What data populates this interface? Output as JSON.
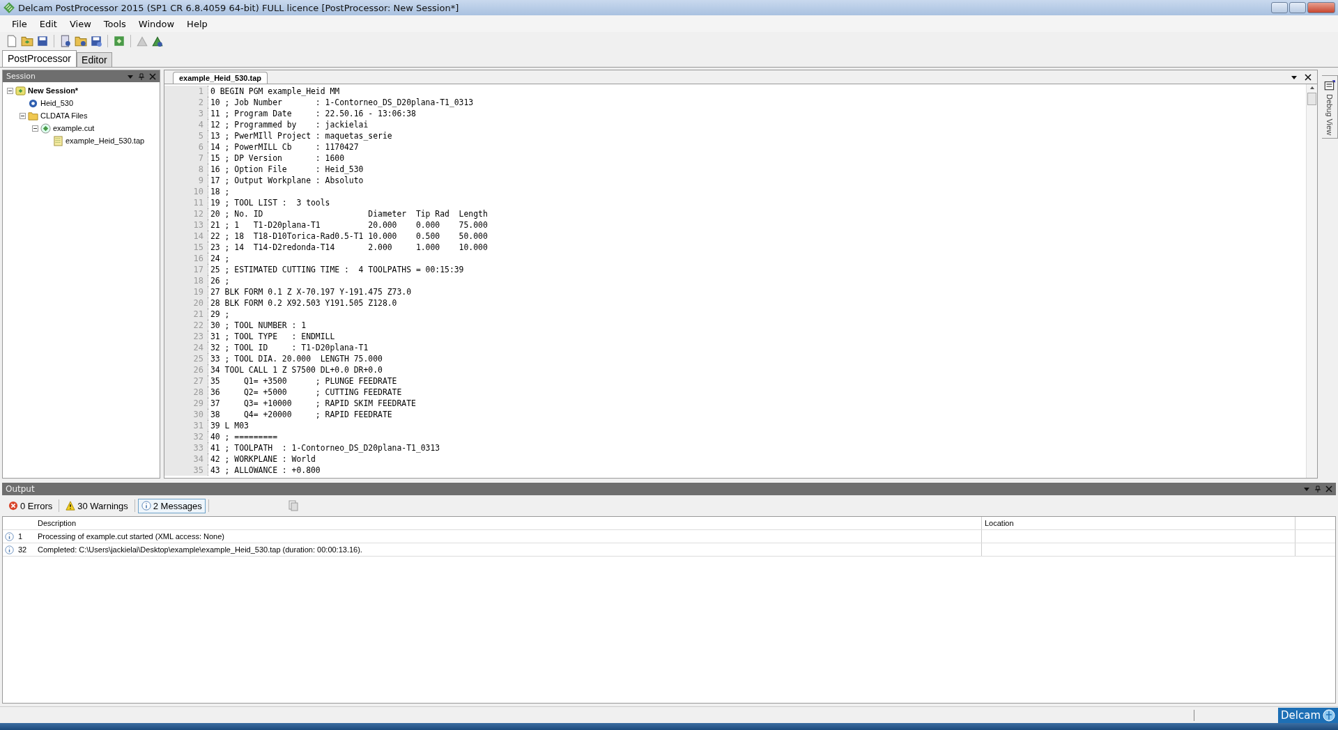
{
  "window": {
    "title": "Delcam PostProcessor 2015 (SP1 CR 6.8.4059 64-bit) FULL licence [PostProcessor: New Session*]"
  },
  "menu": [
    "File",
    "Edit",
    "View",
    "Tools",
    "Window",
    "Help"
  ],
  "tabs": [
    {
      "label": "PostProcessor",
      "selected": true
    },
    {
      "label": "Editor",
      "selected": false
    }
  ],
  "session": {
    "title": "Session",
    "tree": [
      {
        "label": "New Session*",
        "kind": "session",
        "expanded": true,
        "children": [
          {
            "label": "Heid_530",
            "kind": "option"
          },
          {
            "label": "CLDATA Files",
            "kind": "folder",
            "expanded": true,
            "children": [
              {
                "label": "example.cut",
                "kind": "cut",
                "expanded": true,
                "children": [
                  {
                    "label": "example_Heid_530.tap",
                    "kind": "tap"
                  }
                ]
              }
            ]
          }
        ]
      }
    ]
  },
  "editor": {
    "tab": "example_Heid_530.tap",
    "lines": [
      {
        "n": "1",
        "text": "0 BEGIN PGM example_Heid MM"
      },
      {
        "n": "2",
        "text": "10 ; Job Number       : 1-Contorneo_DS_D20plana-T1_0313"
      },
      {
        "n": "3",
        "text": "11 ; Program Date     : 22.50.16 - 13:06:38"
      },
      {
        "n": "4",
        "text": "12 ; Programmed by    : jackielai"
      },
      {
        "n": "5",
        "text": "13 ; PwerMIll Project : maquetas_serie"
      },
      {
        "n": "6",
        "text": "14 ; PowerMILL Cb     : 1170427"
      },
      {
        "n": "7",
        "text": "15 ; DP Version       : 1600"
      },
      {
        "n": "8",
        "text": "16 ; Option File      : Heid_530"
      },
      {
        "n": "9",
        "text": "17 ; Output Workplane : Absoluto"
      },
      {
        "n": "10",
        "text": "18 ;"
      },
      {
        "n": "11",
        "text": "19 ; TOOL LIST :  3 tools"
      },
      {
        "n": "12",
        "text": "20 ; No. ID                      Diameter  Tip Rad  Length"
      },
      {
        "n": "13",
        "text": "21 ; 1   T1-D20plana-T1          20.000    0.000    75.000"
      },
      {
        "n": "14",
        "text": "22 ; 18  T18-D10Torica-Rad0.5-T1 10.000    0.500    50.000"
      },
      {
        "n": "15",
        "text": "23 ; 14  T14-D2redonda-T14       2.000     1.000    10.000"
      },
      {
        "n": "16",
        "text": "24 ;"
      },
      {
        "n": "17",
        "text": "25 ; ESTIMATED CUTTING TIME :  4 TOOLPATHS = 00:15:39"
      },
      {
        "n": "18",
        "text": "26 ;"
      },
      {
        "n": "19",
        "text": "27 BLK FORM 0.1 Z X-70.197 Y-191.475 Z73.0"
      },
      {
        "n": "20",
        "text": "28 BLK FORM 0.2 X92.503 Y191.505 Z128.0"
      },
      {
        "n": "21",
        "text": "29 ;"
      },
      {
        "n": "22",
        "text": "30 ; TOOL NUMBER : 1"
      },
      {
        "n": "23",
        "text": "31 ; TOOL TYPE   : ENDMILL"
      },
      {
        "n": "24",
        "text": "32 ; TOOL ID     : T1-D20plana-T1"
      },
      {
        "n": "25",
        "text": "33 ; TOOL DIA. 20.000  LENGTH 75.000"
      },
      {
        "n": "26",
        "text": "34 TOOL CALL 1 Z S7500 DL+0.0 DR+0.0"
      },
      {
        "n": "27",
        "text": "35     Q1= +3500      ; PLUNGE FEEDRATE"
      },
      {
        "n": "28",
        "text": "36     Q2= +5000      ; CUTTING FEEDRATE"
      },
      {
        "n": "29",
        "text": "37     Q3= +10000     ; RAPID SKIM FEEDRATE"
      },
      {
        "n": "30",
        "text": "38     Q4= +20000     ; RAPID FEEDRATE"
      },
      {
        "n": "31",
        "text": "39 L M03"
      },
      {
        "n": "32",
        "text": "40 ; ========="
      },
      {
        "n": "33",
        "text": "41 ; TOOLPATH  : 1-Contorneo_DS_D20plana-T1_0313"
      },
      {
        "n": "34",
        "text": "42 ; WORKPLANE : World"
      },
      {
        "n": "35",
        "text": "43 ; ALLOWANCE : +0.800"
      }
    ]
  },
  "debug_view": {
    "label": "Debug View"
  },
  "output": {
    "title": "Output",
    "filters": [
      {
        "kind": "error",
        "label": "0 Errors",
        "selected": false
      },
      {
        "kind": "warning",
        "label": "30 Warnings",
        "selected": false
      },
      {
        "kind": "info",
        "label": "2 Messages",
        "selected": true
      }
    ],
    "columns": [
      "Description",
      "Location"
    ],
    "rows": [
      {
        "kind": "info",
        "number": "1",
        "description": "Processing of example.cut started (XML access: None)"
      },
      {
        "kind": "info",
        "number": "32",
        "description": "Completed: C:\\Users\\jackielai\\Desktop\\example\\example_Heid_530.tap (duration: 00:00:13.16)."
      }
    ]
  },
  "status_bar": {
    "brand": "Delcam"
  }
}
